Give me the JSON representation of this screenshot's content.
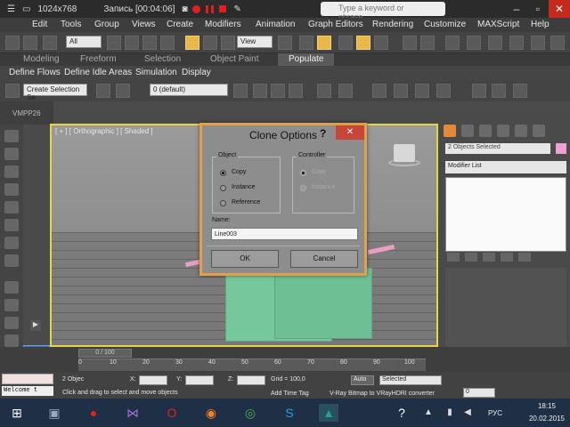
{
  "recorder": {
    "resolution": "1024x768",
    "status": "Запись [00:04:06]",
    "search_placeholder": "Type a keyword or phrase"
  },
  "menu": [
    "Edit",
    "Tools",
    "Group",
    "Views",
    "Create",
    "Modifiers",
    "Animation",
    "Graph Editors",
    "Rendering",
    "Customize",
    "MAXScript",
    "Help"
  ],
  "main_toolbar": {
    "filter": "All",
    "ref_coord": "View"
  },
  "ribbon_tabs": {
    "items": [
      "Modeling",
      "Freeform",
      "Selection",
      "Object Paint"
    ],
    "active": "Populate"
  },
  "subtabs": [
    "Define Flows",
    "Define Idle Areas",
    "Simulation",
    "Display"
  ],
  "sec_toolbar": {
    "selection_set": "Create Selection Se",
    "layer": "0 (default)"
  },
  "vmp_label": "VMPP26",
  "viewport": {
    "label": "[ + ] [ Orthographic ] [ Shaded ]"
  },
  "command_panel": {
    "objects_selected": "2 Objects Selected",
    "modifier_list": "Modifier List"
  },
  "dialog": {
    "title": "Clone Options",
    "help": "?",
    "close": "✕",
    "object_group": "Object",
    "object_options": [
      {
        "label": "Copy",
        "selected": true
      },
      {
        "label": "Instance",
        "selected": false
      },
      {
        "label": "Reference",
        "selected": false
      }
    ],
    "controller_group": "Controller",
    "controller_options": [
      {
        "label": "Copy",
        "selected": true
      },
      {
        "label": "Instance",
        "selected": false
      }
    ],
    "name_label": "Name:",
    "name_value": "Line003",
    "ok_label": "OK",
    "cancel_label": "Cancel"
  },
  "timeline": {
    "slider_label": "0 / 100",
    "ticks": [
      "0",
      "10",
      "20",
      "30",
      "40",
      "50",
      "60",
      "70",
      "80",
      "90",
      "100"
    ]
  },
  "status": {
    "welcome": "Welcome t",
    "selected": "2 Objec",
    "x_label": "X:",
    "y_label": "Y:",
    "z_label": "Z:",
    "grid": "Grid = 100,0",
    "auto": "Auto",
    "selected_dd": "Selected",
    "hint": "Click and drag to select and move objects",
    "add_time_tag": "Add Time Tag",
    "render_msg": "V-Ray Bitmap to VRayHDRI converter",
    "frame": "0"
  },
  "taskbar": {
    "lang": "РУС",
    "time": "18:15",
    "date": "20.02.2015"
  },
  "colors": {
    "viewport_border": "#e8d24a",
    "dialog_border": "#e0a04a",
    "object_green": "#77c79c",
    "close_red": "#c8453a"
  }
}
